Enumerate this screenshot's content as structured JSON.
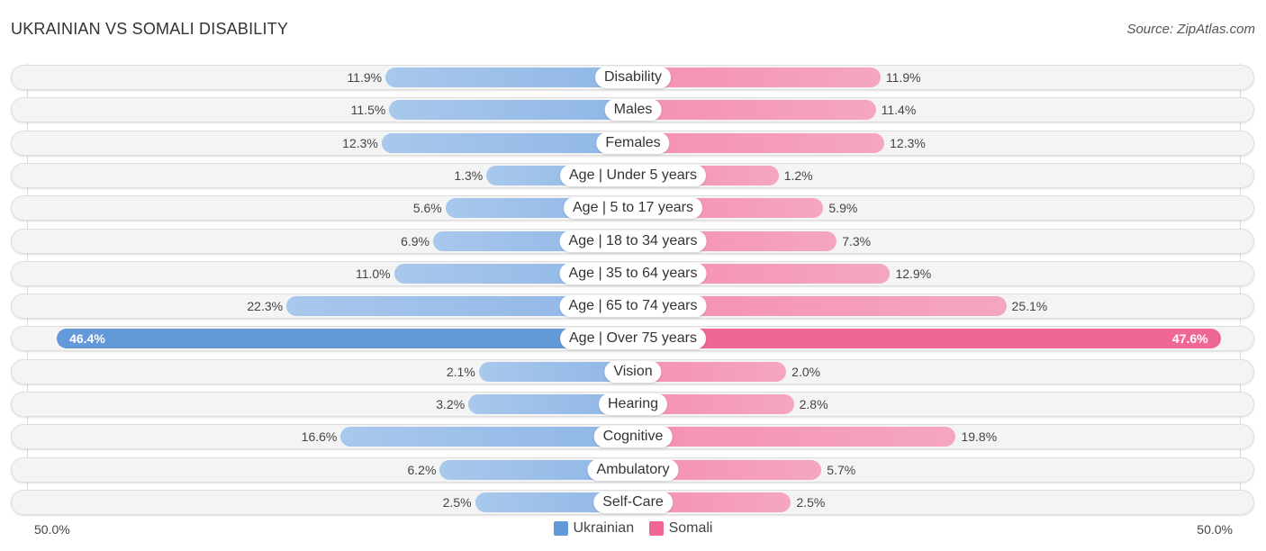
{
  "header": {
    "title": "UKRAINIAN VS SOMALI DISABILITY",
    "source": "Source: ZipAtlas.com"
  },
  "chart_data": {
    "type": "bar",
    "orientation": "horizontal-diverging",
    "title": "UKRAINIAN VS SOMALI DISABILITY",
    "source": "Source: ZipAtlas.com",
    "categories": [
      "Disability",
      "Males",
      "Females",
      "Age | Under 5 years",
      "Age | 5 to 17 years",
      "Age | 18 to 34 years",
      "Age | 35 to 64 years",
      "Age | 65 to 74 years",
      "Age | Over 75 years",
      "Vision",
      "Hearing",
      "Cognitive",
      "Ambulatory",
      "Self-Care"
    ],
    "series": [
      {
        "name": "Ukrainian",
        "color": "#6399d9",
        "side": "left",
        "values": [
          11.9,
          11.5,
          12.3,
          1.3,
          5.6,
          6.9,
          11.0,
          22.3,
          46.4,
          2.1,
          3.2,
          16.6,
          6.2,
          2.5
        ],
        "labels": [
          "11.9%",
          "11.5%",
          "12.3%",
          "1.3%",
          "5.6%",
          "6.9%",
          "11.0%",
          "22.3%",
          "46.4%",
          "2.1%",
          "3.2%",
          "16.6%",
          "6.2%",
          "2.5%"
        ]
      },
      {
        "name": "Somali",
        "color": "#ef6792",
        "side": "right",
        "values": [
          11.9,
          11.4,
          12.3,
          1.2,
          5.9,
          7.3,
          12.9,
          25.1,
          47.6,
          2.0,
          2.8,
          19.8,
          5.7,
          2.5
        ],
        "labels": [
          "11.9%",
          "11.4%",
          "12.3%",
          "1.2%",
          "5.9%",
          "7.3%",
          "12.9%",
          "25.1%",
          "47.6%",
          "2.0%",
          "2.8%",
          "19.8%",
          "5.7%",
          "2.5%"
        ]
      }
    ],
    "highlighted_category": "Age | Over 75 years",
    "xlim": [
      0,
      50
    ],
    "axis_labels": {
      "left": "50.0%",
      "right": "50.0%"
    },
    "unit": "%",
    "legend": {
      "position": "bottom-center",
      "entries": [
        "Ukrainian",
        "Somali"
      ]
    }
  }
}
